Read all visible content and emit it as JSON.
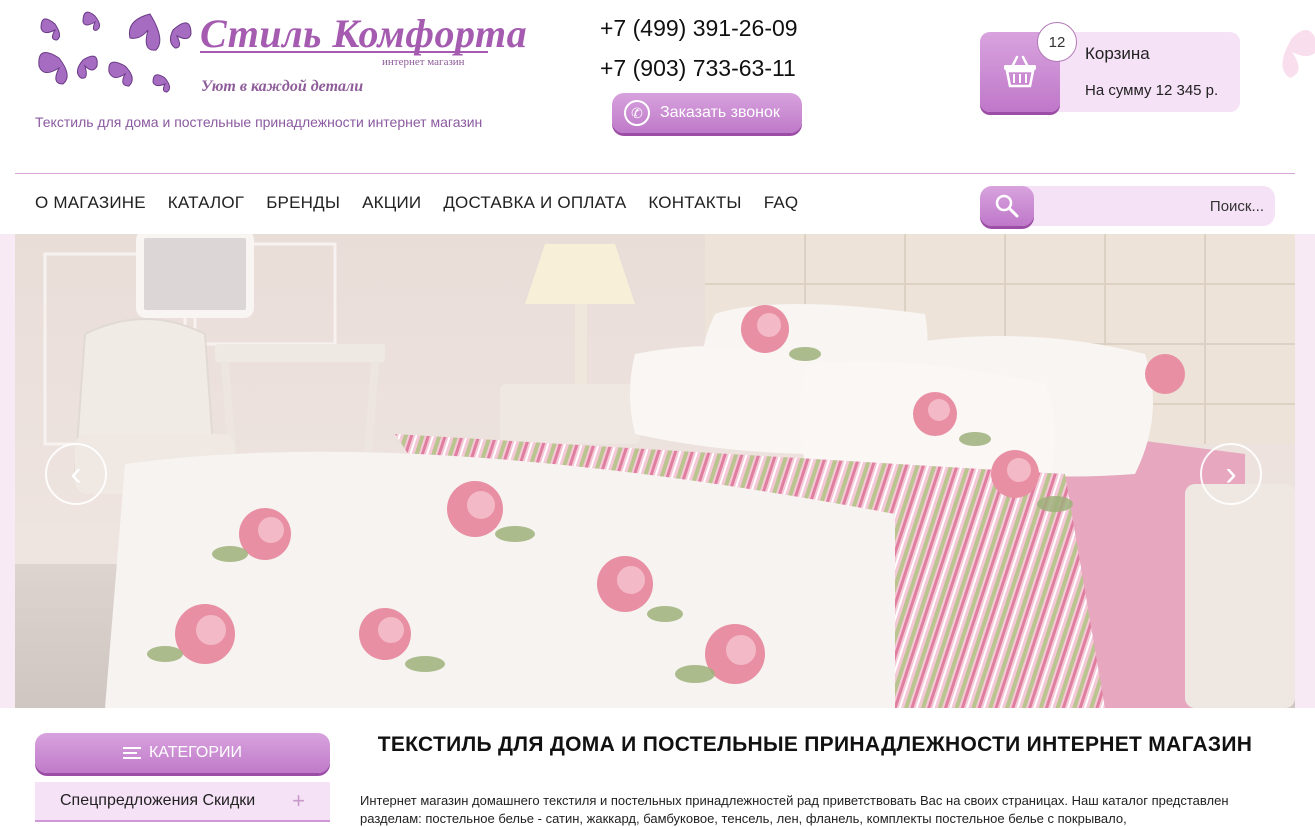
{
  "header": {
    "logo_title": "Стиль Комфорта",
    "logo_subtitle": "интернет магазин",
    "logo_slogan": "Уют в каждой детали",
    "tagline": "Текстиль для дома и постельные принадлежности интернет магазин",
    "phones": [
      "+7 (499) 391-26-09",
      "+7 (903) 733-63-11"
    ],
    "callback_label": "Заказать звонок"
  },
  "cart": {
    "count": "12",
    "title": "Корзина",
    "sum": "На сумму 12 345 р."
  },
  "nav": {
    "items": [
      "О МАГАЗИНЕ",
      "КАТАЛОГ",
      "БРЕНДЫ",
      "АКЦИИ",
      "ДОСТАВКА И ОПЛАТА",
      "КОНТАКТЫ",
      "FAQ"
    ]
  },
  "search": {
    "placeholder": "Поиск..."
  },
  "slider": {
    "prev_icon": "chevron-left-icon",
    "next_icon": "chevron-right-icon"
  },
  "sidebar": {
    "header_label": "КАТЕГОРИИ",
    "items": [
      "Спецпредложения Скидки"
    ]
  },
  "content": {
    "title": "ТЕКСТИЛЬ ДЛЯ ДОМА И ПОСТЕЛЬНЫЕ ПРИНАДЛЕЖНОСТИ ИНТЕРНЕТ МАГАЗИН",
    "text": "Интернет магазин домашнего текстиля и постельных принадлежностей рад приветствовать Вас на своих страницах. Наш каталог представлен разделам: постельное белье - сатин, жаккард, бамбуковое, тенсель, лен, фланель, комплекты постельное белье с покрывало,"
  },
  "colors": {
    "accent": "#c07ac9",
    "accent_light": "#f6e2f6",
    "brand_text": "#a45bb0"
  }
}
